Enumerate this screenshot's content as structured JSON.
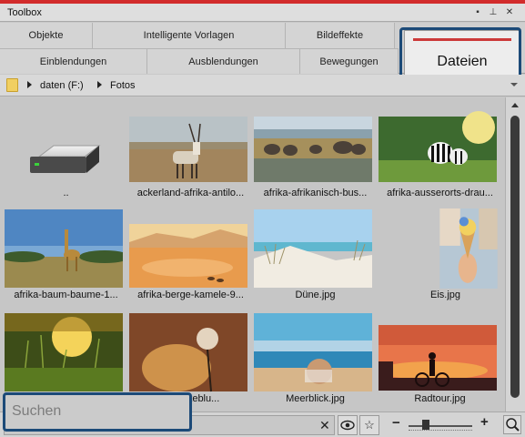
{
  "window": {
    "title": "Toolbox",
    "controls": [
      "▪",
      "📌",
      "✕"
    ]
  },
  "tabs": {
    "row1": [
      "Objekte",
      "Intelligente Vorlagen",
      "Bildeffekte"
    ],
    "row2": [
      "Einblendungen",
      "Ausblendungen",
      "Bewegungen"
    ],
    "active": "Dateien"
  },
  "breadcrumb": {
    "drive": "daten (F:)",
    "folder": "Fotos"
  },
  "files": [
    {
      "name": "..",
      "kind": "drive"
    },
    {
      "name": "ackerland-afrika-antilo...",
      "kind": "photo"
    },
    {
      "name": "afrika-afrikanisch-bus...",
      "kind": "photo"
    },
    {
      "name": "afrika-ausserorts-drau...",
      "kind": "photo"
    },
    {
      "name": "afrika-baum-baume-1...",
      "kind": "photo"
    },
    {
      "name": "afrika-berge-kamele-9...",
      "kind": "photo"
    },
    {
      "name": "Düne.jpg",
      "kind": "photo"
    },
    {
      "name": "Eis.jpg",
      "kind": "photo"
    },
    {
      "name": "",
      "kind": "photo"
    },
    {
      "name": "...-pusteblu...",
      "kind": "photo"
    },
    {
      "name": "Meerblick.jpg",
      "kind": "photo"
    },
    {
      "name": "Radtour.jpg",
      "kind": "photo"
    }
  ],
  "search": {
    "placeholder": "Suchen",
    "clear": "✕"
  },
  "toolbar": {
    "eye_icon": "eye-icon",
    "star_icon": "star-icon",
    "zoom_minus": "−",
    "zoom_plus": "+",
    "zoom_level": 0.25
  }
}
